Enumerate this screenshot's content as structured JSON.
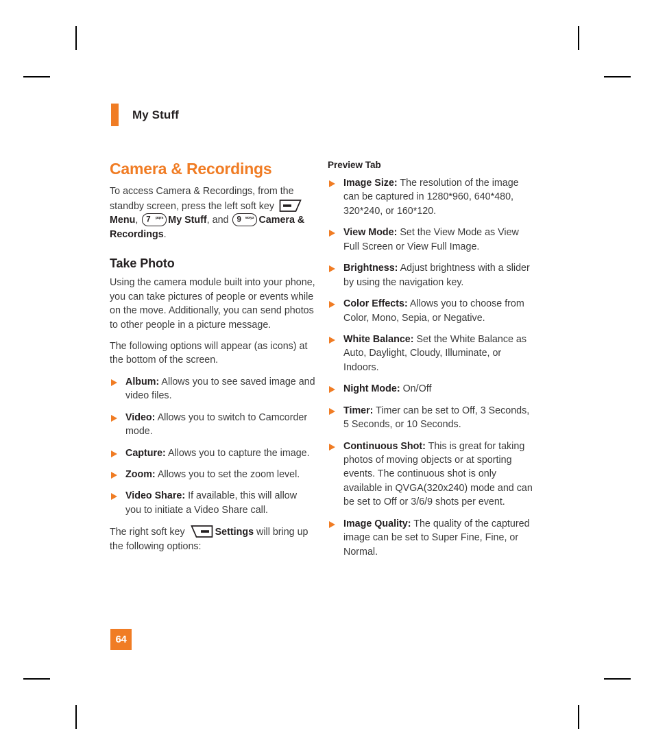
{
  "colors": {
    "accent": "#F07C24",
    "body_text": "#3a3a3a",
    "heading_text": "#231f20"
  },
  "running_head": {
    "title": "My Stuff"
  },
  "folio": {
    "page_number": "64"
  },
  "left_column": {
    "section_title": "Camera & Recordings",
    "intro": {
      "before_softkey": "To access Camera & Recordings, from the standby screen, press the left soft key ",
      "menu_label": "Menu",
      "comma_after_menu": ", ",
      "my_stuff_label": "My Stuff",
      "and_text": ", and ",
      "camera_label": "Camera & Recordings",
      "period": "."
    },
    "keys": {
      "left_soft_key": "left-soft-key-icon",
      "key7_number": "7",
      "key7_letters": "pqrs",
      "key9_number": "9",
      "key9_letters": "wxyz",
      "right_soft_key": "right-soft-key-icon"
    },
    "take_photo_title": "Take Photo",
    "take_photo_para1": "Using the camera module built into your phone, you can take pictures of people or events while on the move. Additionally, you can send photos to other people in a picture message.",
    "take_photo_para2": "The following options will appear (as icons) at the bottom of the screen.",
    "options": [
      {
        "term": "Album:",
        "desc": " Allows you to see saved image and video files."
      },
      {
        "term": "Video:",
        "desc": " Allows you to switch to Camcorder mode."
      },
      {
        "term": "Capture:",
        "desc": " Allows you to capture the image."
      },
      {
        "term": "Zoom:",
        "desc": " Allows you to set the zoom level."
      },
      {
        "term": "Video Share:",
        "desc": " If available, this will allow you to initiate a Video Share call."
      }
    ],
    "settings_para": {
      "before_key": "The right soft key ",
      "settings_label": "Settings",
      "after_key": " will bring up the following options:"
    }
  },
  "right_column": {
    "preview_tab_title": "Preview Tab",
    "options": [
      {
        "term": "Image Size:",
        "desc": " The resolution of the image can be captured in 1280*960, 640*480, 320*240, or 160*120."
      },
      {
        "term": "View Mode:",
        "desc": " Set the View Mode as View Full Screen or View Full Image."
      },
      {
        "term": "Brightness:",
        "desc": " Adjust brightness with a slider by using the navigation key."
      },
      {
        "term": "Color Effects:",
        "desc": " Allows you to choose from Color, Mono, Sepia, or Negative."
      },
      {
        "term": "White Balance:",
        "desc": " Set the White Balance as Auto, Daylight, Cloudy, Illuminate, or Indoors."
      },
      {
        "term": "Night Mode:",
        "desc": " On/Off"
      },
      {
        "term": "Timer:",
        "desc": " Timer can be set to Off, 3 Seconds, 5 Seconds, or 10 Seconds."
      },
      {
        "term": "Continuous Shot:",
        "desc": " This is great for taking photos of moving objects or at sporting events. The continuous shot is only available in QVGA(320x240) mode and can be set to Off or 3/6/9 shots per event."
      },
      {
        "term": "Image Quality:",
        "desc": " The quality of the captured image can be set to Super Fine, Fine, or Normal."
      }
    ]
  }
}
